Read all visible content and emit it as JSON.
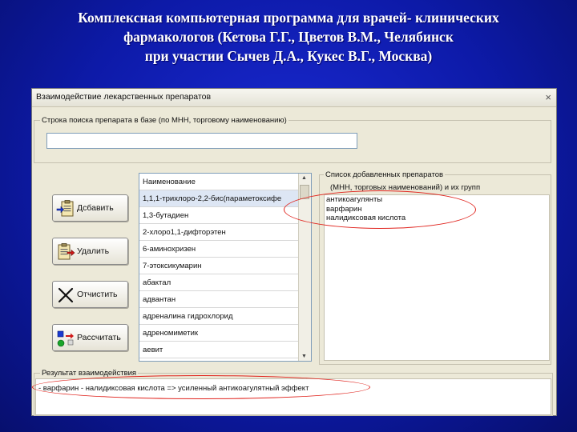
{
  "slide": {
    "title_lines": [
      "Комплексная компьютерная программа  для врачей- клинических",
      "фармакологов (Кетова Г.Г., Цветов В.М., Челябинск",
      "при участии Сычев Д.А., Кукес В.Г., Москва)"
    ]
  },
  "window": {
    "title": "Взаимодействие лекарственных препаратов",
    "close_glyph": "×"
  },
  "search": {
    "group_label": "Строка поиска препарата в базе (по МНН, торговому наименованию)",
    "value": ""
  },
  "buttons": {
    "add": "Дсбавить",
    "delete": "Удалить",
    "clear": "Отчистить",
    "calculate": "Рассчитать"
  },
  "drug_list": {
    "header": "Наименование",
    "items": [
      "1,1,1-трихлоро-2,2-бис(параметоксифе",
      "1,3-бутадиен",
      "2-хлоро1,1-дифторэтен",
      "6-аминохризен",
      "7-этоксикумарин",
      "абактал",
      "адвантан",
      "адреналина гидрохлорид",
      "адреномиметик",
      "аевит"
    ],
    "selected_index": 0
  },
  "added": {
    "group_label_line1": "Список добавленных препаратов",
    "group_label_line2": "(МНН, торговых наименований) и их групп",
    "items": [
      "антикоагулянты",
      "варфарин",
      "налидиксовая кислота"
    ]
  },
  "result": {
    "group_label": "Результат взаимодействия",
    "text": "- варфарин - налидиксовая кислота => усиленный антикоагулятный эффект"
  },
  "colors": {
    "highlight": "#e0241e",
    "background": "#0d1aa8"
  }
}
